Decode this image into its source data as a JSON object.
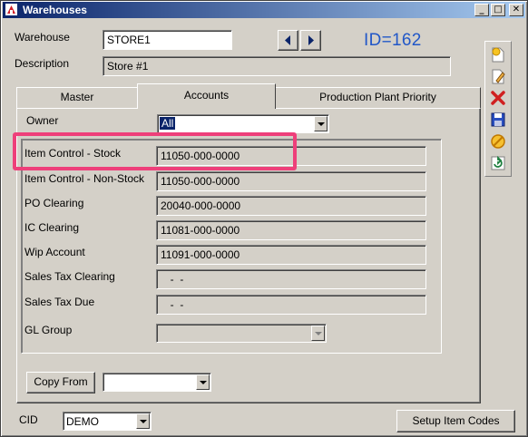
{
  "window": {
    "title": "Warehouses",
    "controls": [
      "_",
      "□",
      "✕"
    ]
  },
  "header": {
    "warehouse_label": "Warehouse",
    "warehouse_value": "STORE1",
    "description_label": "Description",
    "description_value": "Store #1",
    "id_label": "ID=162"
  },
  "tabs": [
    {
      "label": "Master"
    },
    {
      "label": "Accounts"
    },
    {
      "label": "Production Plant Priority"
    }
  ],
  "accounts": {
    "owner_label": "Owner",
    "owner_value": "All",
    "rows": [
      {
        "label": "Item Control - Stock",
        "value": "11050-000-0000"
      },
      {
        "label": "Item Control - Non-Stock",
        "value": "11050-000-0000"
      },
      {
        "label": "PO Clearing",
        "value": "20040-000-0000"
      },
      {
        "label": "IC Clearing",
        "value": "11081-000-0000"
      },
      {
        "label": "Wip Account",
        "value": "11091-000-0000"
      },
      {
        "label": "Sales Tax Clearing",
        "value": "  -  -"
      },
      {
        "label": "Sales Tax Due",
        "value": "  -  -"
      }
    ],
    "gl_group_label": "GL Group",
    "gl_group_value": "",
    "copy_from_label": "Copy From",
    "copy_from_value": ""
  },
  "footer": {
    "cid_label": "CID",
    "cid_value": "DEMO",
    "setup_button": "Setup Item Codes"
  },
  "toolbar_icons": [
    "new-icon",
    "edit-icon",
    "delete-icon",
    "save-icon",
    "cancel-icon",
    "refresh-icon"
  ],
  "colors": {
    "titlebar": "#0a246a",
    "id_text": "#2157c8",
    "highlight": "#ee3f7a",
    "selected": "#0a246a"
  }
}
